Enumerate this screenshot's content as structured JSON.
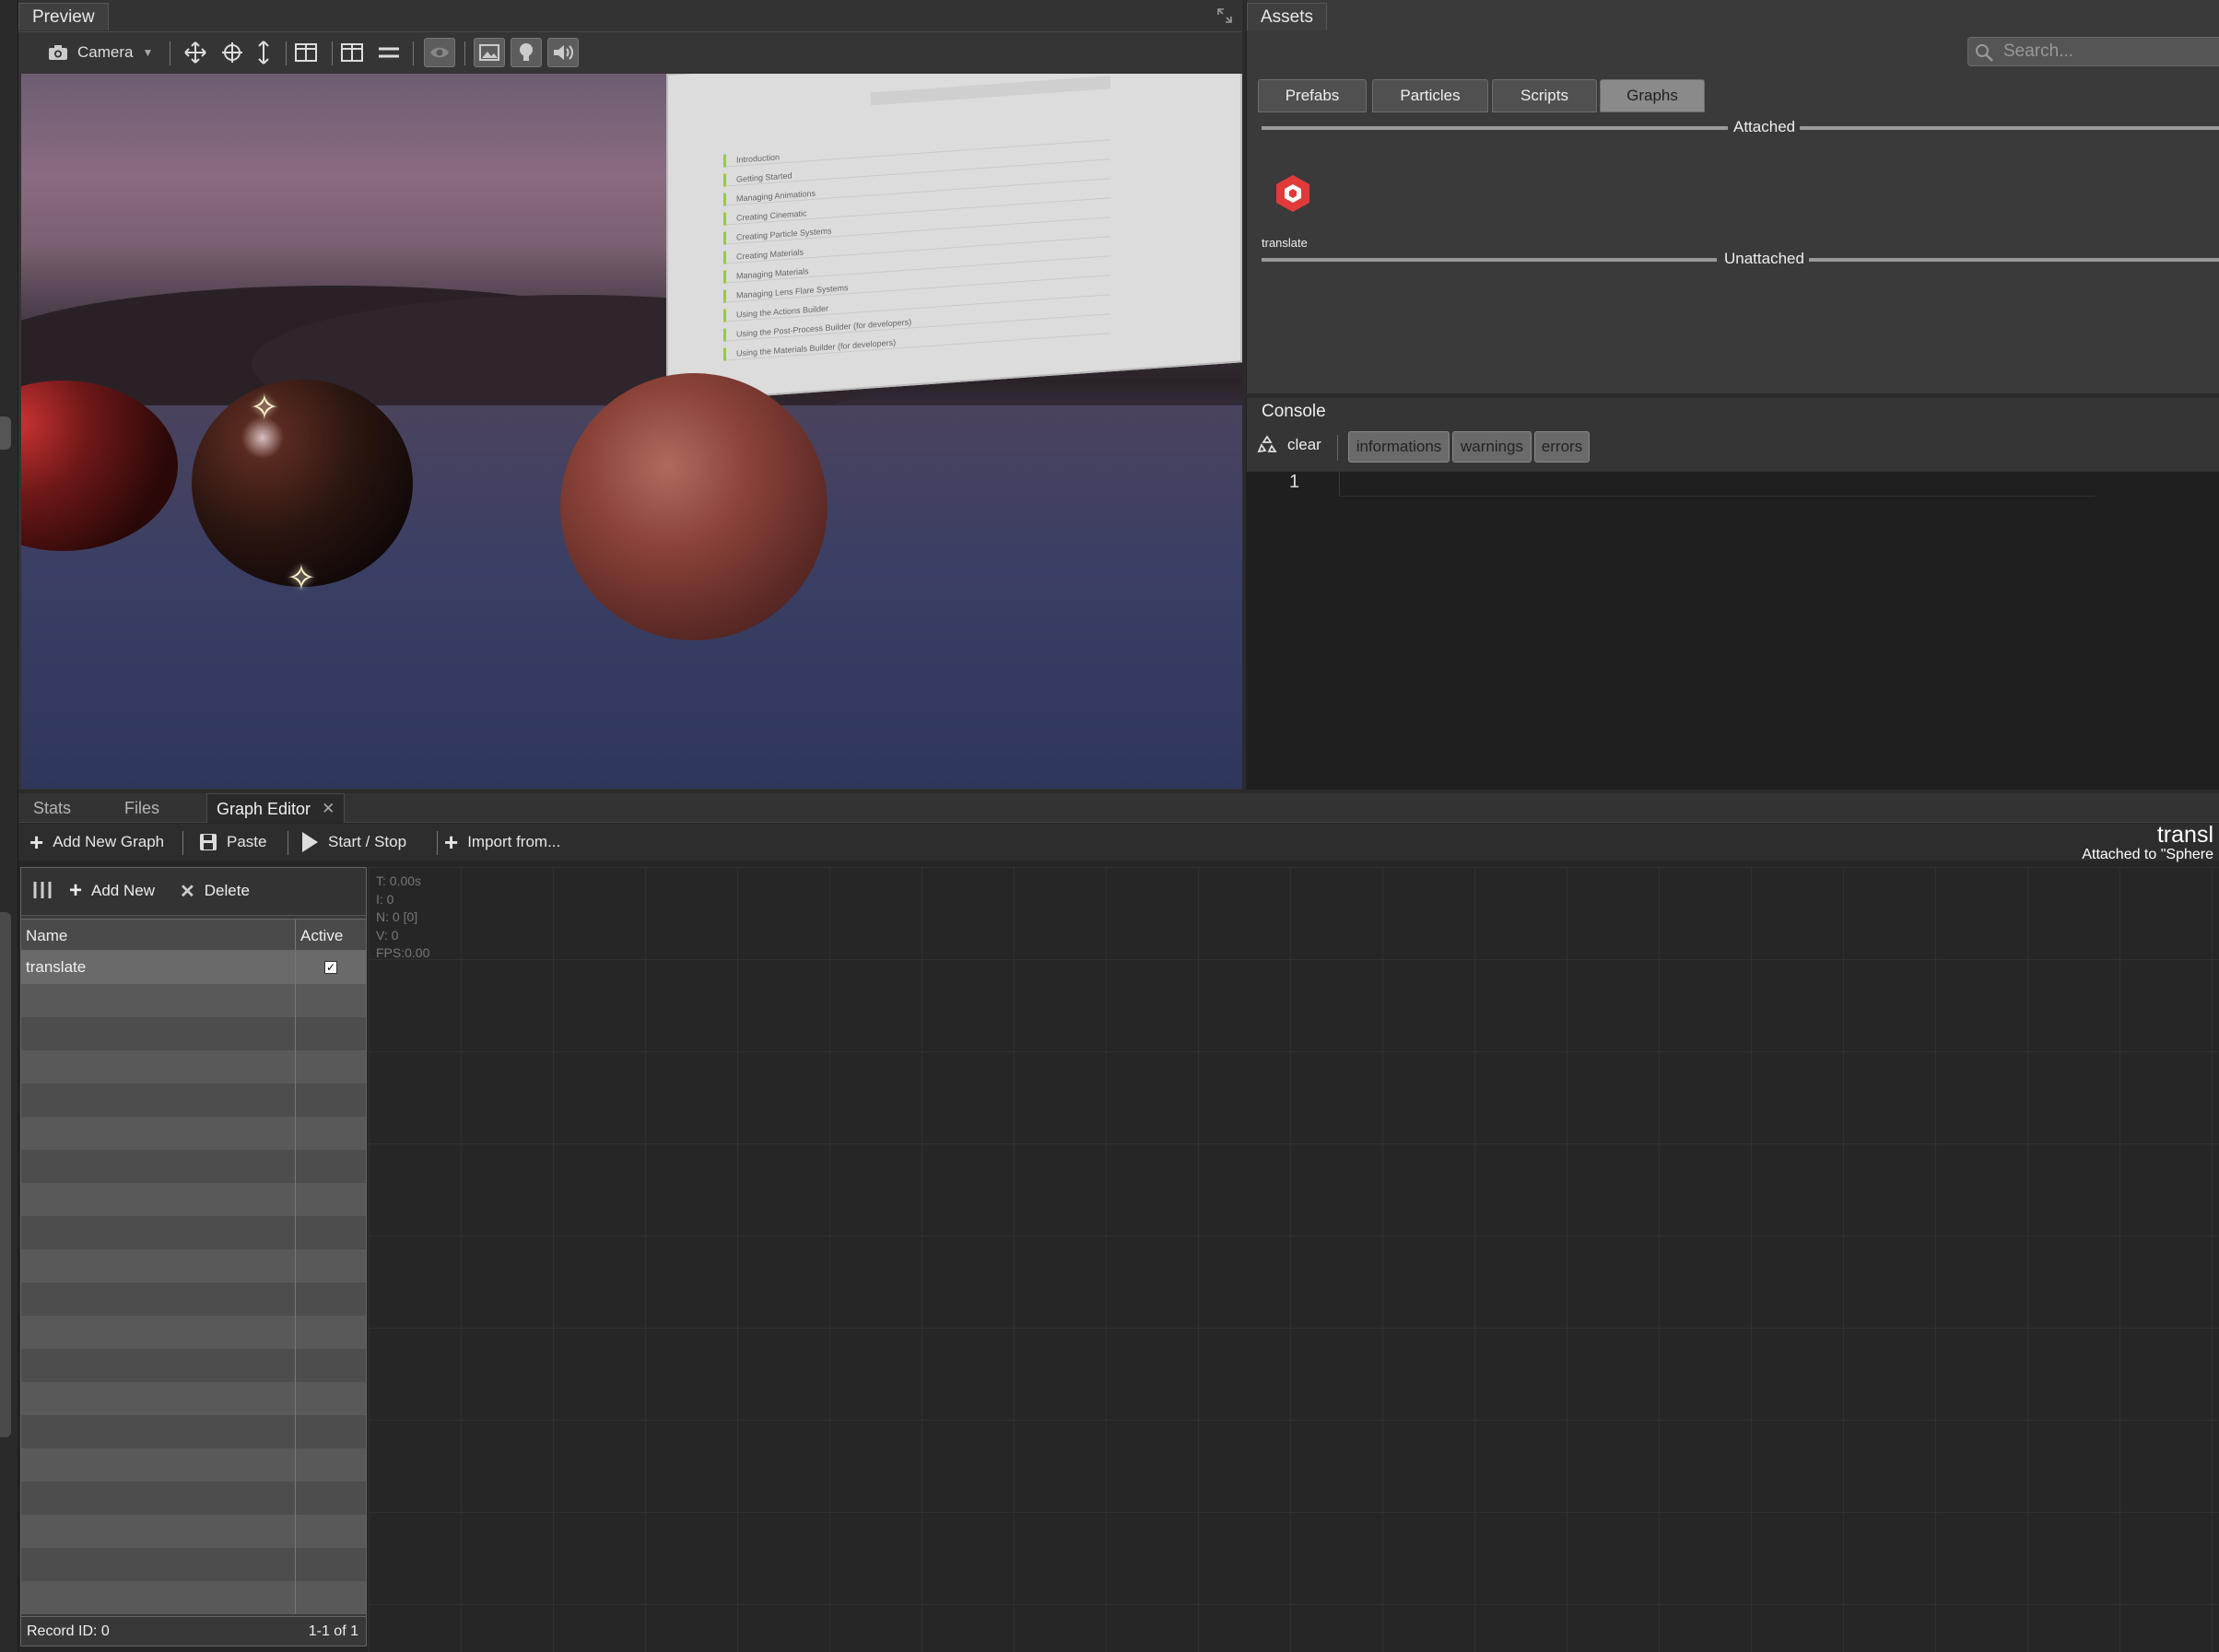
{
  "preview": {
    "tab_label": "Preview",
    "camera_label": "Camera",
    "board_rows": [
      "Introduction",
      "Getting Started",
      "Managing Animations",
      "Creating Cinematic",
      "Creating Particle Systems",
      "Creating Materials",
      "Managing Materials",
      "Managing Lens Flare Systems",
      "Using the Actions Builder",
      "Using the Post-Process Builder (for developers)",
      "Using the Materials Builder (for developers)"
    ]
  },
  "assets": {
    "tab_label": "Assets",
    "search_placeholder": "Search...",
    "tabs": [
      {
        "label": "Prefabs",
        "active": false
      },
      {
        "label": "Particles",
        "active": false
      },
      {
        "label": "Scripts",
        "active": false
      },
      {
        "label": "Graphs",
        "active": true
      }
    ],
    "attached_label": "Attached",
    "unattached_label": "Unattached",
    "attached_items": [
      {
        "label": "translate",
        "icon": "graph-icon"
      }
    ]
  },
  "console": {
    "tab_label": "Console",
    "clear_label": "clear",
    "filters": [
      "informations",
      "warnings",
      "errors"
    ],
    "line_number": "1"
  },
  "bottom": {
    "tabs": [
      {
        "label": "Stats",
        "active": false
      },
      {
        "label": "Files",
        "active": false
      },
      {
        "label": "Graph Editor",
        "active": true,
        "closable": true
      }
    ],
    "toolbar": {
      "add_new_graph": "Add New Graph",
      "paste": "Paste",
      "start_stop": "Start / Stop",
      "import_from": "Import from..."
    },
    "graph_title": "transl",
    "graph_subtitle": "Attached to \"Sphere"
  },
  "graph_list": {
    "toolbar": {
      "add_new": "Add New",
      "delete": "Delete"
    },
    "columns": [
      "Name",
      "Active"
    ],
    "rows": [
      {
        "name": "translate",
        "active": true
      }
    ],
    "footer_left": "Record ID: 0",
    "footer_right": "1-1 of 1"
  },
  "graph_stats": [
    "T: 0.00s",
    "I: 0",
    "N: 0 [0]",
    "V: 0",
    "FPS:0.00"
  ],
  "colors": {
    "panel": "#3a3a3a",
    "active_tab": "#8a8a8a",
    "graph_icon": "#e03a3a"
  }
}
